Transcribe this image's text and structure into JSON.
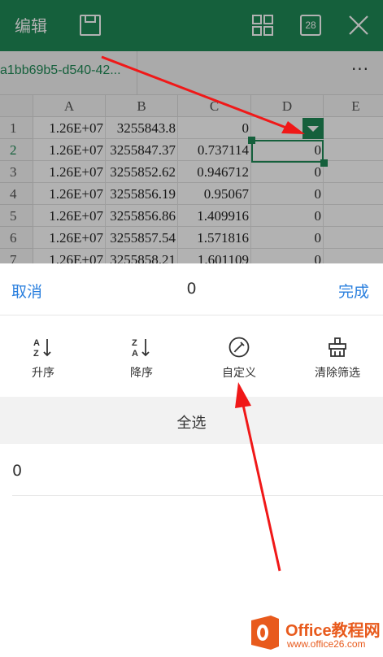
{
  "toolbar": {
    "edit_label": "编辑",
    "calendar_number": "28",
    "save_icon": "save-icon",
    "grid_icon": "grid-icon",
    "close_icon": "close-icon",
    "bg_color": "#1f8a56"
  },
  "file": {
    "name": "a1bb69b5-d540-42...",
    "more": "···"
  },
  "sheet": {
    "columns": [
      "A",
      "B",
      "C",
      "D",
      "E"
    ],
    "rows": [
      {
        "num": "1",
        "cells": [
          "1.26E+07",
          "3255843.8",
          "0",
          ""
        ]
      },
      {
        "num": "2",
        "cells": [
          "1.26E+07",
          "3255847.37",
          "0.737114",
          "0"
        ]
      },
      {
        "num": "3",
        "cells": [
          "1.26E+07",
          "3255852.62",
          "0.946712",
          "0"
        ]
      },
      {
        "num": "4",
        "cells": [
          "1.26E+07",
          "3255856.19",
          "0.95067",
          "0"
        ]
      },
      {
        "num": "5",
        "cells": [
          "1.26E+07",
          "3255856.86",
          "1.409916",
          "0"
        ]
      },
      {
        "num": "6",
        "cells": [
          "1.26E+07",
          "3255857.54",
          "1.571816",
          "0"
        ]
      },
      {
        "num": "7",
        "cells": [
          "1.26E+07",
          "3255858.21",
          "1.601109",
          "0"
        ]
      }
    ],
    "accent": "#1f8a56"
  },
  "panel": {
    "cancel": "取消",
    "title": "0",
    "done": "完成",
    "actions": [
      {
        "label": "升序",
        "icon": "sort-ascending-icon"
      },
      {
        "label": "降序",
        "icon": "sort-descending-icon"
      },
      {
        "label": "自定义",
        "icon": "pencil-icon"
      },
      {
        "label": "清除筛选",
        "icon": "clear-filter-icon"
      }
    ],
    "select_all": "全选",
    "options": [
      "0"
    ],
    "link_color": "#2a7fde"
  },
  "watermark": {
    "main": "Office教程网",
    "sub": "www.office26.com",
    "color": "#e85a1c"
  },
  "annotations": {
    "arrow_color": "#f01818"
  }
}
